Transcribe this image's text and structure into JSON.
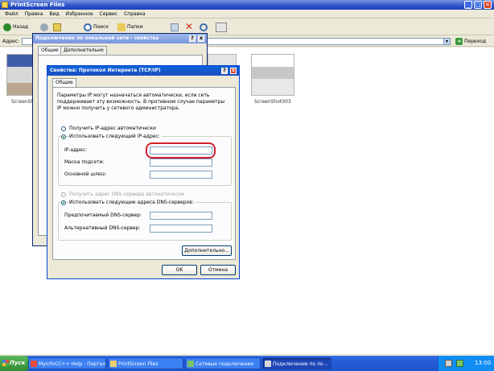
{
  "window": {
    "title": "PrintScreen Files",
    "min": "_",
    "max": "□",
    "close": "✕"
  },
  "menu": [
    "Файл",
    "Правка",
    "Вид",
    "Избранное",
    "Сервис",
    "Справка"
  ],
  "toolbar": {
    "back": "Назад",
    "search": "Поиск",
    "folders": "Папки"
  },
  "address": {
    "label": "Адрес:",
    "value": "",
    "go": "Переход",
    "dropdown": "▾"
  },
  "files": [
    {
      "caption": "ScreenSh"
    },
    {
      "caption": ""
    },
    {
      "caption": "ScreenShot003"
    }
  ],
  "dialog_connection": {
    "title": "Подключение по локальной сети - свойства",
    "help": "?",
    "close": "x",
    "tabs": [
      "Общие",
      "Дополнительно"
    ]
  },
  "dialog_tcpip": {
    "title": "Свойства: Протокол Интернета (TCP/IP)",
    "help": "?",
    "close": "x",
    "tab": "Общие",
    "description": "Параметры IP могут назначаться автоматически, если сеть поддерживает эту возможность. В противном случае параметры IP можно получить у сетевого администратора.",
    "radio_auto_ip": "Получить IP-адрес автоматически",
    "radio_manual_ip": "Использовать следующий IP-адрес:",
    "ip_label": "IP-адрес:",
    "mask_label": "Маска подсети:",
    "gateway_label": "Основной шлюз:",
    "ip_value": ". . .",
    "mask_value": ". . .",
    "gateway_value": ". . .",
    "radio_auto_dns": "Получить адрес DNS-сервера автоматически",
    "radio_manual_dns": "Использовать следующие адреса DNS-серверов:",
    "dns_primary_label": "Предпочитаемый DNS-сервер:",
    "dns_alternate_label": "Альтернативный DNS-сервер:",
    "dns_primary_value": ". . .",
    "dns_alternate_value": ". . .",
    "advanced_button": "Дополнительно...",
    "ok_button": "OK",
    "cancel_button": "Отмена",
    "highlight_color": "#d0202a"
  },
  "taskbar": {
    "start": "Пуск",
    "tasks": [
      {
        "label": "MyInfoCC++ Help - Портал",
        "active": false
      },
      {
        "label": "PrintScreen Files",
        "active": false
      },
      {
        "label": "Сетевые подключения",
        "active": false
      },
      {
        "label": "Подключение по ло...",
        "active": true
      }
    ],
    "clock": "13:00"
  }
}
